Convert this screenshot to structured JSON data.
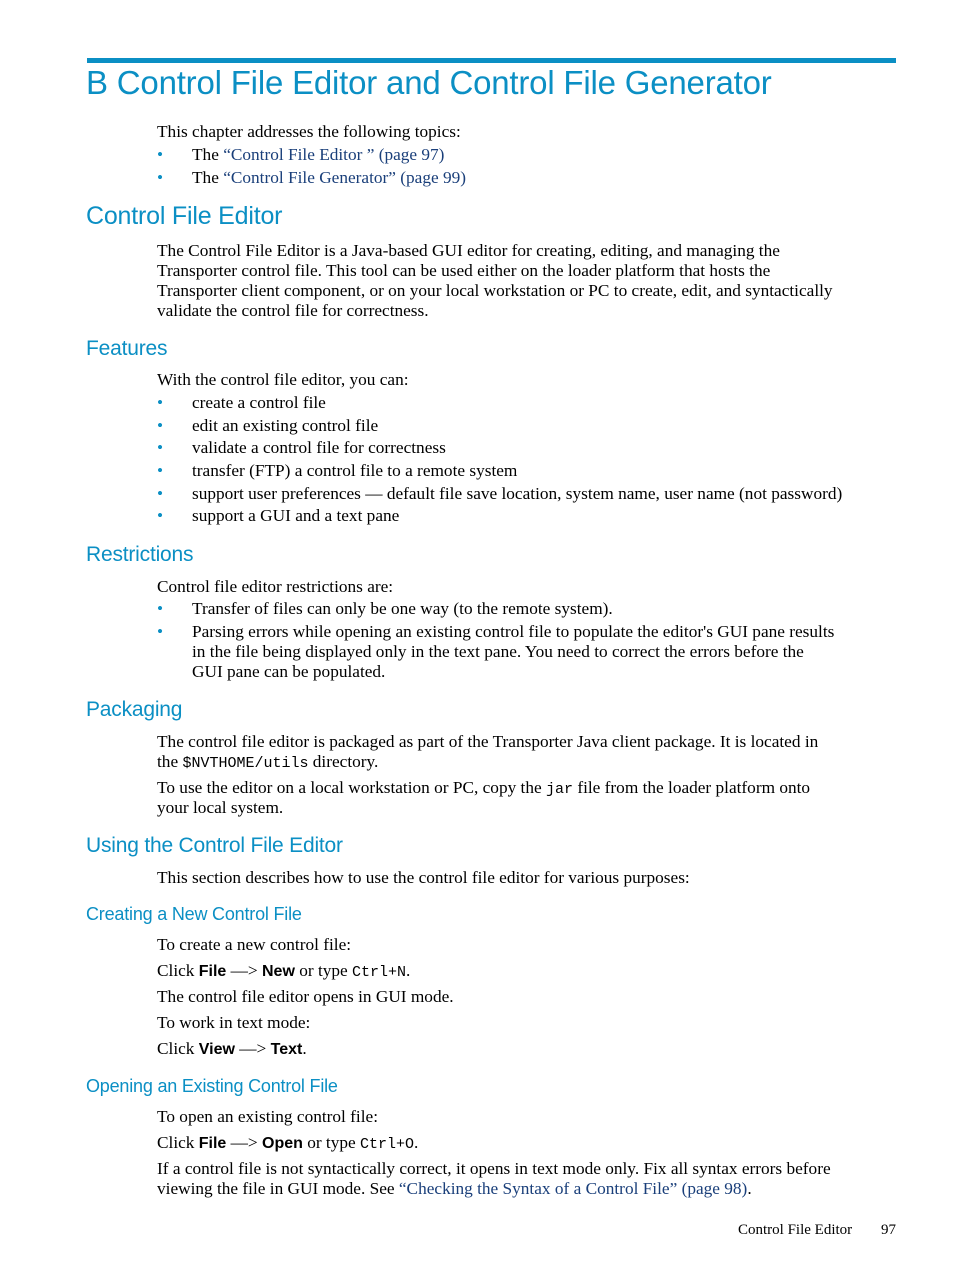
{
  "chapter": {
    "title": "B Control File Editor and Control File Generator",
    "intro": "This chapter addresses the following topics:",
    "topics": [
      {
        "prefix": "The ",
        "link": "“Control File Editor ” (page 97)"
      },
      {
        "prefix": "The ",
        "link": "“Control File Generator” (page 99)"
      }
    ]
  },
  "editor": {
    "heading": "Control File Editor",
    "body": [
      "The Control File Editor is a Java-based GUI editor for creating, editing, and managing the",
      "Transporter control file. This tool can be used either on the loader platform that hosts the",
      "Transporter client component, or on your local workstation or PC to create, edit, and syntactically",
      "validate the control file for correctness."
    ]
  },
  "features": {
    "heading": "Features",
    "intro": "With the control file editor, you can:",
    "items": [
      "create a control file",
      "edit an existing control file",
      "validate a control file for correctness",
      "transfer (FTP) a control file to a remote system",
      "support user preferences — default file save location, system name, user name (not password)",
      "support a GUI and a text pane"
    ]
  },
  "restrictions": {
    "heading": "Restrictions",
    "intro": "Control file editor restrictions are:",
    "items": [
      [
        "Transfer of files can only be one way (to the remote system)."
      ],
      [
        "Parsing errors while opening an existing control file to populate the editor's GUI pane results",
        "in the file being displayed only in the text pane. You need to correct the errors before the",
        "GUI pane can be populated."
      ]
    ]
  },
  "packaging": {
    "heading": "Packaging",
    "p1_line1": "The control file editor is packaged as part of the Transporter Java client package. It is located in",
    "p1_line2_a": "the ",
    "p1_line2_code": "$NVTHOME/utils",
    "p1_line2_b": " directory.",
    "p2_line1_a": "To use the editor on a local workstation or PC, copy the ",
    "p2_line1_code": "jar",
    "p2_line1_b": " file from the loader platform onto",
    "p2_line2": "your local system."
  },
  "using": {
    "heading": "Using the Control File Editor",
    "body": "This section describes how to use the control file editor for various purposes:"
  },
  "creating": {
    "heading": "Creating a New Control File",
    "l1": "To create a new control file:",
    "click": "Click ",
    "file": "File",
    "arrow": " —> ",
    "new": "New",
    "or_type": " or type ",
    "shortcut": "Ctrl+N",
    "period": ".",
    "l3": "The control file editor opens in GUI mode.",
    "l4": "To work in text mode:",
    "view": "View",
    "text": "Text"
  },
  "opening": {
    "heading": "Opening an Existing Control File",
    "l1": "To open an existing control file:",
    "click": "Click ",
    "file": "File",
    "arrow": " —> ",
    "open": "Open",
    "or_type": " or type ",
    "shortcut": "Ctrl+O",
    "period": ".",
    "p_line1": "If a control file is not syntactically correct, it opens in text mode only. Fix all syntax errors before",
    "p_line2_a": "viewing the file in GUI mode. See ",
    "p_line2_link": "“Checking the Syntax of a Control File” (page 98)",
    "p_line2_b": "."
  },
  "footer": {
    "section": "Control File Editor",
    "page": "97"
  }
}
